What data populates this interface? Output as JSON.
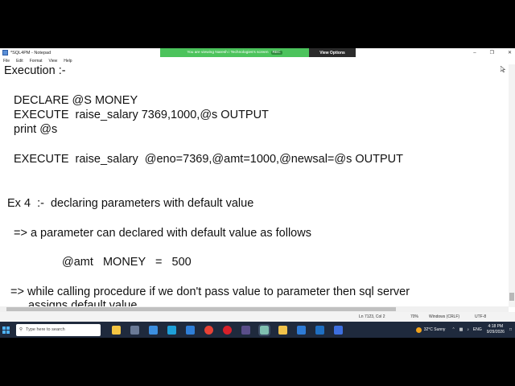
{
  "window": {
    "title": "*SQL4PM - Notepad",
    "menu": [
      "File",
      "Edit",
      "Format",
      "View",
      "Help"
    ]
  },
  "share_banner": {
    "text": "You are viewing Naresh i Technologies's screen",
    "rec": "REC",
    "view_options": "View Options"
  },
  "editor": {
    "lines": [
      "Execution :-",
      "DECLARE @S MONEY",
      "EXECUTE  raise_salary 7369,1000,@s OUTPUT",
      "print @s",
      "EXECUTE  raise_salary  @eno=7369,@amt=1000,@newsal=@s OUTPUT",
      "Ex 4  :-  declaring parameters with default value",
      "=> a parameter can declared with default value as follows",
      "@amt   MONEY   =   500",
      "=> while calling procedure if we don't pass value to parameter then sql server",
      "assigns default value"
    ]
  },
  "status": {
    "position": "Ln 7123, Col 2",
    "zoom": "70%",
    "line_ending": "Windows (CRLF)",
    "encoding": "UTF-8"
  },
  "taskbar": {
    "search_placeholder": "Type here to search",
    "weather": "32°C  Sunny",
    "language": "ENG",
    "time": "4:18 PM",
    "date": "9/29/2026"
  }
}
